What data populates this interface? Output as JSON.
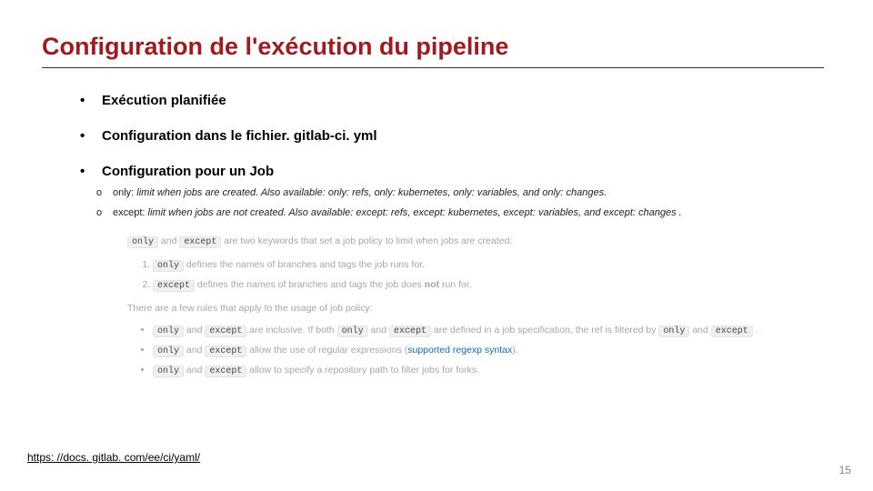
{
  "title": "Configuration de l'exécution du pipeline",
  "bullets": [
    "Exécution planifiée",
    "Configuration dans le fichier",
    "Configuration pour un Job"
  ],
  "filename": ". gitlab-ci. yml",
  "sub": {
    "only_lead": "only: ",
    "only_desc": "limit when jobs are created. Also available: only: refs, only: kubernetes, only: variables, and only: changes.",
    "except_lead": "except: ",
    "except_desc": "limit when jobs are not created. Also available: except: refs, except: kubernetes, except: variables, and except: changes ."
  },
  "box": {
    "intro_a": " and ",
    "intro_b": " are two keywords that set a job policy to limit when jobs are created:",
    "li1_b": " defines the names of branches and tags the job runs for.",
    "li2_b": " defines the names of branches and tags the job does ",
    "li2_not": "not",
    "li2_c": " run for.",
    "rules_intro": "There are a few rules that apply to the usage of job policy:",
    "u1_a": " and ",
    "u1_b": " are inclusive. If both ",
    "u1_c": " and ",
    "u1_d": " are defined in a job specification, the ref is filtered by ",
    "u1_e": " and ",
    "u1_f": " .",
    "u2_a": " and ",
    "u2_b": " allow the use of regular expressions (",
    "u2_link": "supported regexp syntax",
    "u2_c": ").",
    "u3_a": " and ",
    "u3_b": " allow to specify a repository path to filter jobs for forks."
  },
  "kw_only": "only",
  "kw_except": "except",
  "footer_link": "https: //docs. gitlab. com/ee/ci/yaml/",
  "page_number": "15"
}
